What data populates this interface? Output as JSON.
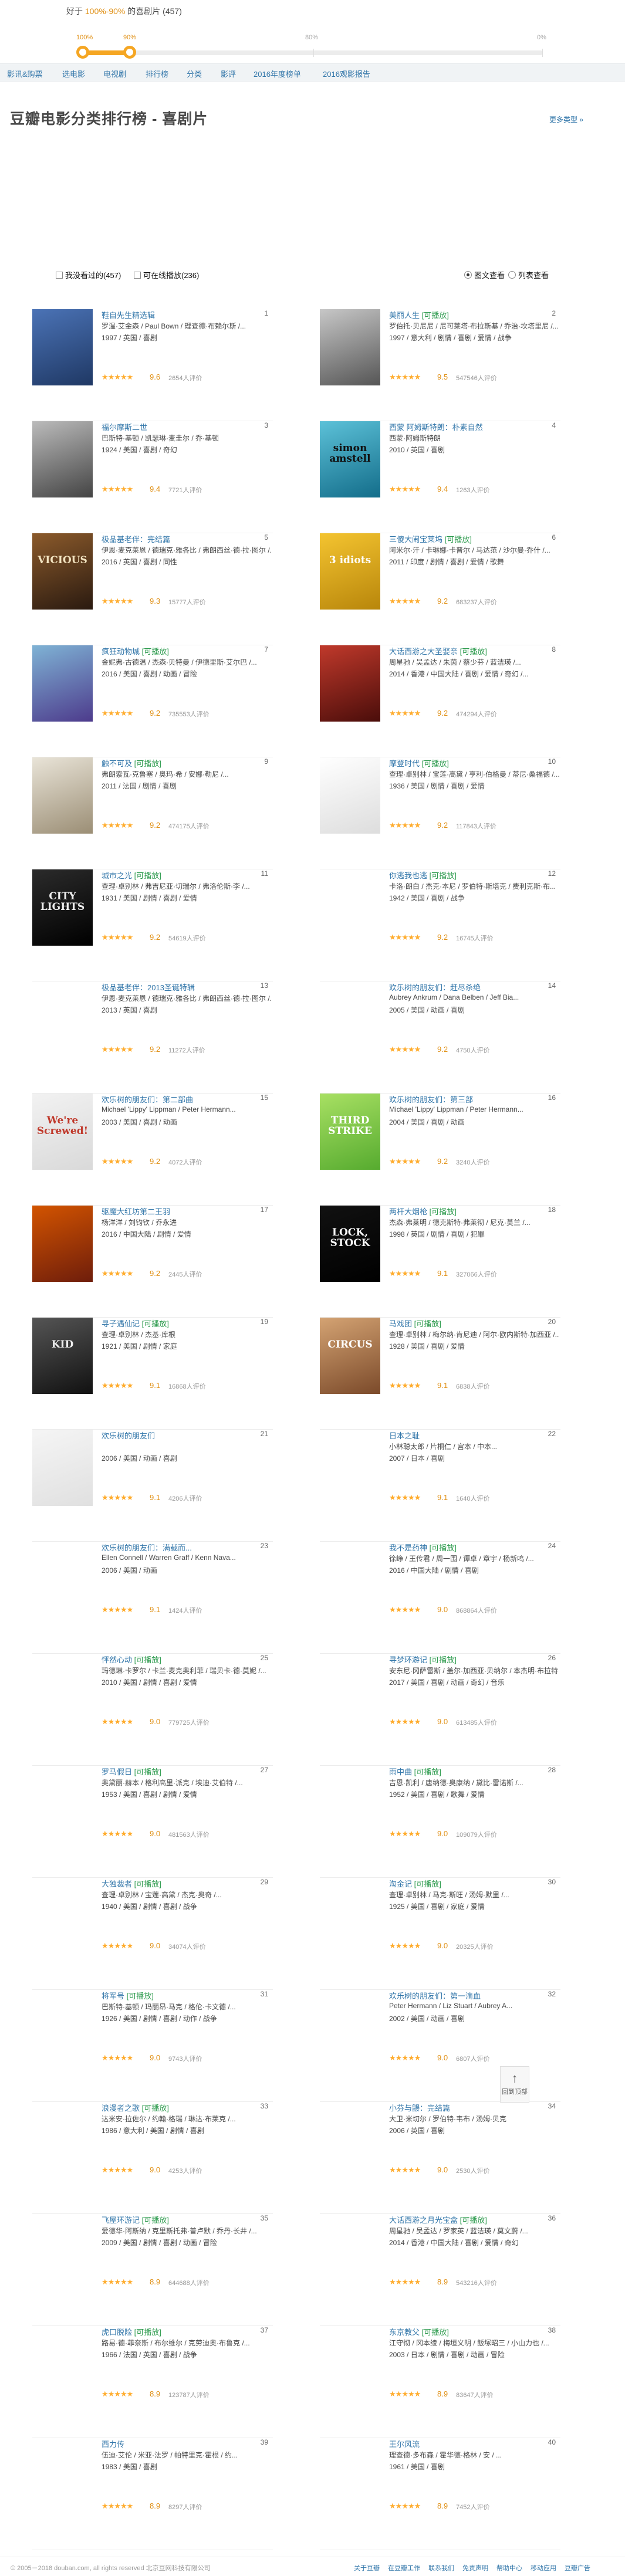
{
  "filter": {
    "prefix": "好于",
    "range": "100%-90%",
    "suffix": "的喜剧片",
    "count": "(457)",
    "progress": 0.1
  },
  "slider": {
    "marks": [
      {
        "label": "100%",
        "hl": true
      },
      {
        "label": "90%",
        "hl": true
      },
      {
        "label": "80%",
        "hl": false
      },
      {
        "label": "0%",
        "hl": false
      }
    ]
  },
  "nav": {
    "items": [
      "影讯&购票",
      "选电影",
      "电视剧",
      "排行榜",
      "分类",
      "影评",
      "2016年度榜单",
      "2016观影报告"
    ]
  },
  "page": {
    "title": "豆瓣电影分类排行榜 - 喜剧片",
    "more_types": "更多类型 »"
  },
  "controls": {
    "seen": "我没看过的(457)",
    "playable": "可在线播放(236)",
    "view_img": "图文查看",
    "view_list": "列表查看"
  },
  "movies": [
    {
      "rank": "1",
      "title": "鞋自先生精选辑",
      "playable": "",
      "l1": "罗温·艾金森 / Paul Bown / 理查德·布赖尔斯 /...",
      "l2": "1997 / 英国 / 喜剧",
      "score": "9.6",
      "stars": 5,
      "votes": "2654人评价",
      "c1": "#4b73b6",
      "c2": "#1f3864",
      "pt": "",
      "pc": "#fff"
    },
    {
      "rank": "2",
      "title": "美丽人生",
      "playable": "[可播放]",
      "l1": "罗伯托·贝尼尼 / 尼可莱塔·布拉斯基 / 乔治·坎塔里尼 /...",
      "l2": "1997 / 意大利 / 剧情 / 喜剧 / 爱情 / 战争",
      "score": "9.5",
      "stars": 5,
      "votes": "547546人评价",
      "c1": "#c7c7c7",
      "c2": "#555",
      "pt": "",
      "pc": "#fff"
    },
    {
      "rank": "3",
      "title": "福尔摩斯二世",
      "playable": "",
      "l1": "巴斯特·基顿 / 凯瑟琳·麦圭尔 / 乔·基顿",
      "l2": "1924 / 美国 / 喜剧 / 奇幻",
      "score": "9.4",
      "stars": 5,
      "votes": "7721人评价",
      "c1": "#bbb",
      "c2": "#444",
      "pt": "",
      "pc": "#fff"
    },
    {
      "rank": "4",
      "title": "西蒙 阿姆斯特朗：朴素自然",
      "playable": "",
      "l1": "西蒙·阿姆斯特朗",
      "l2": "2010 / 英国 / 喜剧",
      "score": "9.4",
      "stars": 5,
      "votes": "1263人评价",
      "c1": "#5cc1d8",
      "c2": "#136d8a",
      "pt": "simon amstell",
      "pc": "#111"
    },
    {
      "rank": "5",
      "title": "极品基老伴：完结篇",
      "playable": "",
      "l1": "伊恩·麦克莱恩 / 德瑞克·雅各比 / 弗朗西丝·德·拉·图尔 /...",
      "l2": "2016 / 英国 / 喜剧 / 同性",
      "score": "9.3",
      "stars": 5,
      "votes": "15777人评价",
      "c1": "#8b5a2b",
      "c2": "#2a1a10",
      "pt": "VICIOUS",
      "pc": "#f2e3c0"
    },
    {
      "rank": "6",
      "title": "三傻大闹宝莱坞",
      "playable": "[可播放]",
      "l1": "阿米尔·汗 / 卡琳娜·卡普尔 / 马达范 / 沙尔曼·乔什 /...",
      "l2": "2011 / 印度 / 剧情 / 喜剧 / 爱情 / 歌舞",
      "score": "9.2",
      "stars": 5,
      "votes": "683237人评价",
      "c1": "#f4c430",
      "c2": "#b8860b",
      "pt": "3 idiots",
      "pc": "#fff"
    },
    {
      "rank": "7",
      "title": "疯狂动物城",
      "playable": "[可播放]",
      "l1": "金妮弗·古德温 / 杰森·贝特曼 / 伊德里斯·艾尔巴 /...",
      "l2": "2016 / 美国 / 喜剧 / 动画 / 冒险",
      "score": "9.2",
      "stars": 5,
      "votes": "735553人评价",
      "c1": "#7fb3d5",
      "c2": "#4d3b8c",
      "pt": "",
      "pc": "#fff"
    },
    {
      "rank": "8",
      "title": "大话西游之大圣娶亲",
      "playable": "[可播放]",
      "l1": "周星驰 / 吴孟达 / 朱茵 / 蔡少芬 / 蓝洁瑛 /...",
      "l2": "2014 / 香港 / 中国大陆 / 喜剧 / 爱情 / 奇幻 /...",
      "score": "9.2",
      "stars": 5,
      "votes": "474294人评价",
      "c1": "#c0392b",
      "c2": "#4a0d0a",
      "pt": "",
      "pc": "#fff"
    },
    {
      "rank": "9",
      "title": "触不可及",
      "playable": "[可播放]",
      "l1": "弗朗索瓦·克鲁塞 / 奥玛·希 / 安娜·勒尼 /...",
      "l2": "2011 / 法国 / 剧情 / 喜剧",
      "score": "9.2",
      "stars": 5,
      "votes": "474175人评价",
      "c1": "#e9e4d8",
      "c2": "#9b8e75",
      "pt": "",
      "pc": "#fff"
    },
    {
      "rank": "10",
      "title": "摩登时代",
      "playable": "[可播放]",
      "l1": "查理·卓别林 / 宝莲·高黛 / 亨利·伯格曼 / 蒂尼·桑福德 /...",
      "l2": "1936 / 美国 / 剧情 / 喜剧 / 爱情",
      "score": "9.2",
      "stars": 5,
      "votes": "117843人评价",
      "c1": "#ffffff",
      "c2": "#dddddd",
      "pt": "",
      "pc": "#111"
    },
    {
      "rank": "11",
      "title": "城市之光",
      "playable": "[可播放]",
      "l1": "查理·卓别林 / 弗吉尼亚·切瑞尔 / 弗洛伦斯·李 /...",
      "l2": "1931 / 美国 / 剧情 / 喜剧 / 爱情",
      "score": "9.2",
      "stars": 5,
      "votes": "54619人评价",
      "c1": "#2b2b2b",
      "c2": "#000",
      "pt": "CITY LIGHTS",
      "pc": "#eee"
    },
    {
      "rank": "12",
      "title": "你逃我也逃",
      "playable": "[可播放]",
      "l1": "卡洛·朗白 / 杰克·本尼 / 罗伯特·斯塔克 / 费利克斯·布...",
      "l2": "1942 / 美国 / 喜剧 / 战争",
      "score": "9.2",
      "stars": 5,
      "votes": "16745人评价",
      "c1": "#fff",
      "c2": "#fff",
      "pt": "",
      "pc": "#111"
    },
    {
      "rank": "13",
      "title": "极品基老伴：2013圣诞特辑",
      "playable": "",
      "l1": "伊恩·麦克莱恩 / 德瑞克·雅各比 / 弗朗西丝·德·拉·图尔 /...",
      "l2": "2013 / 英国 / 喜剧",
      "score": "9.2",
      "stars": 5,
      "votes": "11272人评价",
      "c1": "#fff",
      "c2": "#fff",
      "pt": "",
      "pc": "#111"
    },
    {
      "rank": "14",
      "title": "欢乐树的朋友们：赶尽杀绝",
      "playable": "",
      "l1": "Aubrey Ankrum / Dana Belben / Jeff Bia...",
      "l2": "2005 / 美国 / 动画 / 喜剧",
      "score": "9.2",
      "stars": 5,
      "votes": "4750人评价",
      "c1": "#fff",
      "c2": "#fff",
      "pt": "",
      "pc": "#111"
    },
    {
      "rank": "15",
      "title": "欢乐树的朋友们：第二部曲",
      "playable": "",
      "l1": "Michael 'Lippy' Lippman / Peter Hermann...",
      "l2": "2003 / 美国 / 喜剧 / 动画",
      "score": "9.2",
      "stars": 5,
      "votes": "4072人评价",
      "c1": "#f2f2f2",
      "c2": "#d9d9d9",
      "pt": "We're Screwed!",
      "pc": "#c0392b"
    },
    {
      "rank": "16",
      "title": "欢乐树的朋友们：第三部",
      "playable": "",
      "l1": "Michael 'Lippy' Lippman / Peter Hermann...",
      "l2": "2004 / 美国 / 喜剧 / 动画",
      "score": "9.2",
      "stars": 5,
      "votes": "3240人评价",
      "c1": "#a8e063",
      "c2": "#56ab2f",
      "pt": "THIRD STRIKE",
      "pc": "#fff"
    },
    {
      "rank": "17",
      "title": "驱魔大红坊第二王羽",
      "playable": "",
      "l1": "杨洋洋 / 刘钧钦 / 乔永进",
      "l2": "2016 / 中国大陆 / 剧情 / 爱情",
      "score": "9.2",
      "stars": 5,
      "votes": "2445人评价",
      "c1": "#d35400",
      "c2": "#6e1d0b",
      "pt": "",
      "pc": "#fff"
    },
    {
      "rank": "18",
      "title": "两杆大烟枪",
      "playable": "[可播放]",
      "l1": "杰森·弗莱明 / 德克斯特·弗莱彻 / 尼克·莫兰 /...",
      "l2": "1998 / 英国 / 剧情 / 喜剧 / 犯罪",
      "score": "9.1",
      "stars": 5,
      "votes": "327066人评价",
      "c1": "#111",
      "c2": "#000",
      "pt": "LOCK, STOCK",
      "pc": "#fff"
    },
    {
      "rank": "19",
      "title": "寻子遇仙记",
      "playable": "[可播放]",
      "l1": "查理·卓别林 / 杰基·库根",
      "l2": "1921 / 美国 / 剧情 / 家庭",
      "score": "9.1",
      "stars": 5,
      "votes": "16868人评价",
      "c1": "#555",
      "c2": "#111",
      "pt": "KID",
      "pc": "#eee"
    },
    {
      "rank": "20",
      "title": "马戏团",
      "playable": "[可播放]",
      "l1": "查理·卓别林 / 梅尔纳·肯尼迪 / 阿尔·欧内斯特·加西亚 /...",
      "l2": "1928 / 美国 / 喜剧 / 爱情",
      "score": "9.1",
      "stars": 5,
      "votes": "6838人评价",
      "c1": "#d4a373",
      "c2": "#7b4a2a",
      "pt": "CIRCUS",
      "pc": "#fff"
    },
    {
      "rank": "21",
      "title": "欢乐树的朋友们",
      "playable": "",
      "l1": "",
      "l2": "2006 / 美国 / 动画 / 喜剧",
      "score": "9.1",
      "stars": 5,
      "votes": "4206人评价",
      "c1": "#f5f5f5",
      "c2": "#e0e0e0",
      "pt": "",
      "pc": "#111"
    },
    {
      "rank": "22",
      "title": "日本之耻",
      "playable": "",
      "l1": "小林聪太郎 / 片桐仁 / 宫本 / 中本...",
      "l2": "2007 / 日本 / 喜剧",
      "score": "9.1",
      "stars": 5,
      "votes": "1640人评价",
      "c1": "#fff",
      "c2": "#fff",
      "pt": "",
      "pc": "#111"
    },
    {
      "rank": "23",
      "title": "欢乐树的朋友们：满载而...",
      "playable": "",
      "l1": "Ellen Connell / Warren Graff / Kenn Nava...",
      "l2": "2006 / 美国 / 动画",
      "score": "9.1",
      "stars": 5,
      "votes": "1424人评价",
      "c1": "#fff",
      "c2": "#fff",
      "pt": "",
      "pc": "#111"
    },
    {
      "rank": "24",
      "title": "我不是药神",
      "playable": "[可播放]",
      "l1": "徐峥 / 王传君 / 周一围 / 谭卓 / 章宇 / 杨新鸣 /...",
      "l2": "2016 / 中国大陆 / 剧情 / 喜剧",
      "score": "9.0",
      "stars": 5,
      "votes": "868864人评价",
      "c1": "#fff",
      "c2": "#fff",
      "pt": "",
      "pc": "#111"
    },
    {
      "rank": "25",
      "title": "怦然心动",
      "playable": "[可播放]",
      "l1": "玛德琳·卡罗尔 / 卡兰·麦克奥利菲 / 瑞贝卡·德·莫妮 /...",
      "l2": "2010 / 美国 / 剧情 / 喜剧 / 爱情",
      "score": "9.0",
      "stars": 5,
      "votes": "779725人评价",
      "c1": "#fff",
      "c2": "#fff",
      "pt": "",
      "pc": "#111"
    },
    {
      "rank": "26",
      "title": "寻梦环游记",
      "playable": "[可播放]",
      "l1": "安东尼·冈萨雷斯 / 盖尔·加西亚·贝纳尔 / 本杰明·布拉特 /...",
      "l2": "2017 / 美国 / 喜剧 / 动画 / 奇幻 / 音乐",
      "score": "9.0",
      "stars": 5,
      "votes": "613485人评价",
      "c1": "#fff",
      "c2": "#fff",
      "pt": "",
      "pc": "#111"
    },
    {
      "rank": "27",
      "title": "罗马假日",
      "playable": "[可播放]",
      "l1": "奥黛丽·赫本 / 格利高里·派克 / 埃迪·艾伯特 /...",
      "l2": "1953 / 美国 / 喜剧 / 剧情 / 爱情",
      "score": "9.0",
      "stars": 5,
      "votes": "481563人评价",
      "c1": "#fff",
      "c2": "#fff",
      "pt": "",
      "pc": "#111"
    },
    {
      "rank": "28",
      "title": "雨中曲",
      "playable": "[可播放]",
      "l1": "吉恩·凯利 / 唐纳德·奥康纳 / 黛比·雷诺斯 /...",
      "l2": "1952 / 美国 / 喜剧 / 歌舞 / 爱情",
      "score": "9.0",
      "stars": 5,
      "votes": "109079人评价",
      "c1": "#fff",
      "c2": "#fff",
      "pt": "",
      "pc": "#111"
    },
    {
      "rank": "29",
      "title": "大独裁者",
      "playable": "[可播放]",
      "l1": "查理·卓别林 / 宝莲·高黛 / 杰克·奥奇 /...",
      "l2": "1940 / 美国 / 剧情 / 喜剧 / 战争",
      "score": "9.0",
      "stars": 5,
      "votes": "34074人评价",
      "c1": "#fff",
      "c2": "#fff",
      "pt": "",
      "pc": "#111"
    },
    {
      "rank": "30",
      "title": "淘金记",
      "playable": "[可播放]",
      "l1": "查理·卓别林 / 马克·斯旺 / 汤姆·默里 /...",
      "l2": "1925 / 美国 / 喜剧 / 家庭 / 爱情",
      "score": "9.0",
      "stars": 5,
      "votes": "20325人评价",
      "c1": "#fff",
      "c2": "#fff",
      "pt": "",
      "pc": "#111"
    },
    {
      "rank": "31",
      "title": "将军号",
      "playable": "[可播放]",
      "l1": "巴斯特·基顿 / 玛丽昂·马克 / 格伦·卡文德 /...",
      "l2": "1926 / 美国 / 剧情 / 喜剧 / 动作 / 战争",
      "score": "9.0",
      "stars": 5,
      "votes": "9743人评价",
      "c1": "#fff",
      "c2": "#fff",
      "pt": "",
      "pc": "#111"
    },
    {
      "rank": "32",
      "title": "欢乐树的朋友们：第一滴血",
      "playable": "",
      "l1": "Peter Hermann / Liz Stuart / Aubrey A...",
      "l2": "2002 / 美国 / 动画 / 喜剧",
      "score": "9.0",
      "stars": 5,
      "votes": "6807人评价",
      "c1": "#fff",
      "c2": "#fff",
      "pt": "",
      "pc": "#111"
    },
    {
      "rank": "33",
      "title": "浪漫者之歌",
      "playable": "[可播放]",
      "l1": "达米安·拉佐尔 / 约翰·格瑞 / 琳达·布莱克 /...",
      "l2": "1986 / 意大利 / 美国 / 剧情 / 喜剧",
      "score": "9.0",
      "stars": 5,
      "votes": "4253人评价",
      "c1": "#fff",
      "c2": "#fff",
      "pt": "",
      "pc": "#111"
    },
    {
      "rank": "34",
      "title": "小芬与鼹：完结篇",
      "playable": "",
      "l1": "大卫·米切尔 / 罗伯特·韦布 / 汤姆·贝克",
      "l2": "2006 / 英国 / 喜剧",
      "score": "9.0",
      "stars": 5,
      "votes": "2530人评价",
      "c1": "#fff",
      "c2": "#fff",
      "pt": "",
      "pc": "#111"
    },
    {
      "rank": "35",
      "title": "飞屋环游记",
      "playable": "[可播放]",
      "l1": "爱德华·阿斯纳 / 克里斯托弗·普卢默 / 乔丹·长井 /...",
      "l2": "2009 / 美国 / 剧情 / 喜剧 / 动画 / 冒险",
      "score": "8.9",
      "stars": 5,
      "votes": "644688人评价",
      "c1": "#fff",
      "c2": "#fff",
      "pt": "",
      "pc": "#111"
    },
    {
      "rank": "36",
      "title": "大话西游之月光宝盒",
      "playable": "[可播放]",
      "l1": "周星驰 / 吴孟达 / 罗家英 / 蓝洁瑛 / 莫文蔚 /...",
      "l2": "2014 / 香港 / 中国大陆 / 喜剧 / 爱情 / 奇幻",
      "score": "8.9",
      "stars": 5,
      "votes": "543216人评价",
      "c1": "#fff",
      "c2": "#fff",
      "pt": "",
      "pc": "#111"
    },
    {
      "rank": "37",
      "title": "虎口脱险",
      "playable": "[可播放]",
      "l1": "路易·德·菲奈斯 / 布尔维尔 / 克劳迪奥·布鲁克 /...",
      "l2": "1966 / 法国 / 英国 / 喜剧 / 战争",
      "score": "8.9",
      "stars": 5,
      "votes": "123787人评价",
      "c1": "#fff",
      "c2": "#fff",
      "pt": "",
      "pc": "#111"
    },
    {
      "rank": "38",
      "title": "东京教父",
      "playable": "[可播放]",
      "l1": "江守彻 / 冈本绫 / 梅垣义明 / 飯塚昭三 / 小山力也 /...",
      "l2": "2003 / 日本 / 剧情 / 喜剧 / 动画 / 冒险",
      "score": "8.9",
      "stars": 5,
      "votes": "83647人评价",
      "c1": "#fff",
      "c2": "#fff",
      "pt": "",
      "pc": "#111"
    },
    {
      "rank": "39",
      "title": "西力传",
      "playable": "",
      "l1": "伍迪·艾伦 / 米亚·法罗 / 帕特里克·霍根 / 约...",
      "l2": "1983 / 美国 / 喜剧",
      "score": "8.9",
      "stars": 5,
      "votes": "8297人评价",
      "c1": "#fff",
      "c2": "#fff",
      "pt": "",
      "pc": "#111"
    },
    {
      "rank": "40",
      "title": "王尔风流",
      "playable": "",
      "l1": "理查德·多布森 / 霍华德·格林 / 安 / ...",
      "l2": "1961 / 美国 / 喜剧",
      "score": "8.9",
      "stars": 5,
      "votes": "7452人评价",
      "c1": "#fff",
      "c2": "#fff",
      "pt": "",
      "pc": "#111"
    }
  ],
  "totop": {
    "label": "回到顶部",
    "arrow": "↑"
  },
  "footer": {
    "copy": "© 2005－2018 douban.com, all rights reserved 北京豆网科技有限公司",
    "links": [
      "关于豆瓣",
      "在豆瓣工作",
      "联系我们",
      "免责声明",
      "帮助中心",
      "移动应用",
      "豆瓣广告"
    ]
  }
}
